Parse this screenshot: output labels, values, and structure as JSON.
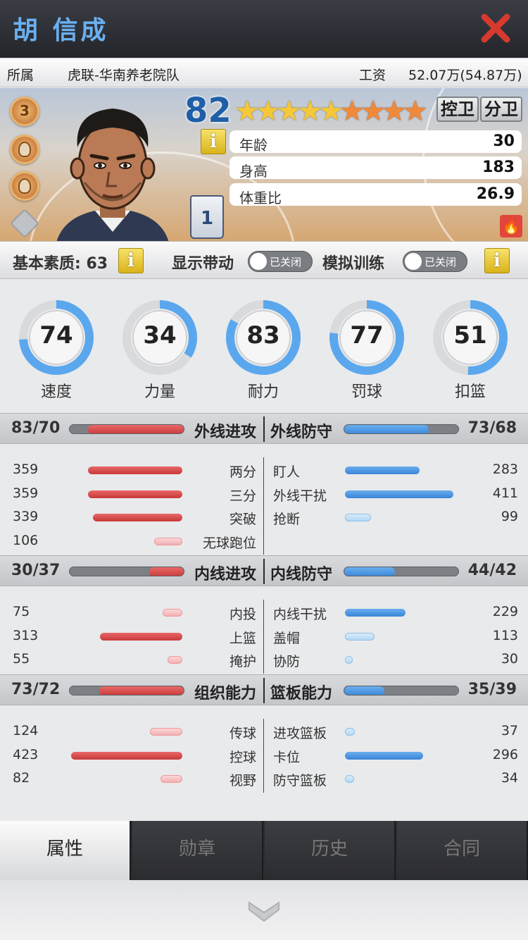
{
  "header": {
    "player_name": "胡 信成"
  },
  "info": {
    "team_label": "所属",
    "team": "虎联-华南养老院队",
    "salary_label": "工资",
    "salary": "52.07万(54.87万)"
  },
  "player": {
    "rating": "82",
    "stars_total": 9,
    "stars_gold": 5,
    "positions": [
      "控卫",
      "分卫"
    ],
    "badge_level": "3",
    "jersey": "1",
    "profile": [
      {
        "label": "年龄",
        "value": "30"
      },
      {
        "label": "身高",
        "value": "183"
      },
      {
        "label": "体重比",
        "value": "26.9"
      }
    ]
  },
  "quality": {
    "label": "基本素质: 63",
    "show_label": "显示带动",
    "show_state": "已关闭",
    "sim_label": "模拟训练",
    "sim_state": "已关闭"
  },
  "rings": [
    {
      "value": "74",
      "label": "速度",
      "pct": 74
    },
    {
      "value": "34",
      "label": "力量",
      "pct": 34
    },
    {
      "value": "83",
      "label": "耐力",
      "pct": 83
    },
    {
      "value": "77",
      "label": "罚球",
      "pct": 77
    },
    {
      "value": "51",
      "label": "扣篮",
      "pct": 51
    }
  ],
  "sections": [
    {
      "left": {
        "value": "83/70",
        "label": "外线进攻",
        "fill": 0.83
      },
      "right": {
        "value": "73/68",
        "label": "外线防守",
        "fill": 0.73
      },
      "left_rows": [
        {
          "label": "两分",
          "value": "359"
        },
        {
          "label": "三分",
          "value": "359"
        },
        {
          "label": "突破",
          "value": "339"
        },
        {
          "label": "无球跑位",
          "value": "106"
        }
      ],
      "right_rows": [
        {
          "label": "盯人",
          "value": "283"
        },
        {
          "label": "外线干扰",
          "value": "411"
        },
        {
          "label": "抢断",
          "value": "99"
        }
      ]
    },
    {
      "left": {
        "value": "30/37",
        "label": "内线进攻",
        "fill": 0.3
      },
      "right": {
        "value": "44/42",
        "label": "内线防守",
        "fill": 0.44
      },
      "left_rows": [
        {
          "label": "内投",
          "value": "75"
        },
        {
          "label": "上篮",
          "value": "313"
        },
        {
          "label": "掩护",
          "value": "55"
        }
      ],
      "right_rows": [
        {
          "label": "内线干扰",
          "value": "229"
        },
        {
          "label": "盖帽",
          "value": "113"
        },
        {
          "label": "协防",
          "value": "30"
        }
      ]
    },
    {
      "left": {
        "value": "73/72",
        "label": "组织能力",
        "fill": 0.73
      },
      "right": {
        "value": "35/39",
        "label": "篮板能力",
        "fill": 0.35
      },
      "left_rows": [
        {
          "label": "传球",
          "value": "124"
        },
        {
          "label": "控球",
          "value": "423"
        },
        {
          "label": "视野",
          "value": "82"
        }
      ],
      "right_rows": [
        {
          "label": "进攻篮板",
          "value": "37"
        },
        {
          "label": "卡位",
          "value": "296"
        },
        {
          "label": "防守篮板",
          "value": "34"
        }
      ]
    }
  ],
  "tabs": [
    "属性",
    "勋章",
    "历史",
    "合同"
  ],
  "colors": {
    "accent": "#6ab0f0",
    "close": "#d63a2e",
    "ring_blue": "#5aa7ee",
    "bar_red": "#d94a4a",
    "bar_blue": "#4a94e0"
  }
}
